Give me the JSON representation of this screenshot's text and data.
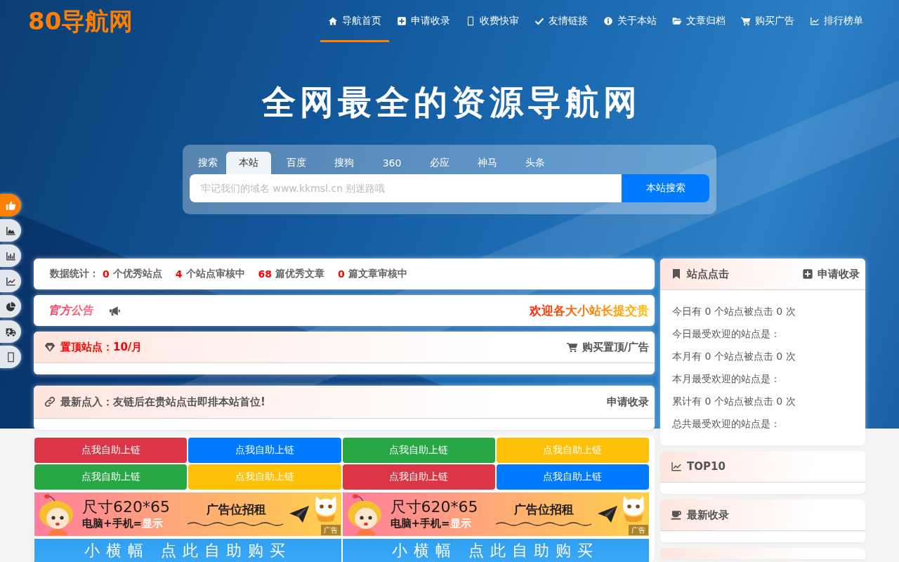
{
  "header": {
    "logo": "80导航网",
    "nav": [
      {
        "label": "导航首页",
        "selected": true
      },
      {
        "label": "申请收录",
        "selected": false
      },
      {
        "label": "收费快审",
        "selected": false
      },
      {
        "label": "友情链接",
        "selected": false
      },
      {
        "label": "关于本站",
        "selected": false
      },
      {
        "label": "文章归档",
        "selected": false
      },
      {
        "label": "购买广告",
        "selected": false
      },
      {
        "label": "排行榜单",
        "selected": false
      }
    ]
  },
  "hero": {
    "title": "全网最全的资源导航网"
  },
  "search": {
    "label": "搜索",
    "tabs": [
      {
        "label": "本站",
        "selected": true
      },
      {
        "label": "百度",
        "selected": false
      },
      {
        "label": "搜狗",
        "selected": false
      },
      {
        "label": "360",
        "selected": false
      },
      {
        "label": "必应",
        "selected": false
      },
      {
        "label": "神马",
        "selected": false
      },
      {
        "label": "头条",
        "selected": false
      }
    ],
    "placeholder": "牢记我们的域名 www.kkmsl.cn 别迷路哦",
    "button": "本站搜索"
  },
  "side_toolbar": [
    {
      "selected": true
    },
    {
      "selected": false
    },
    {
      "selected": false
    },
    {
      "selected": false
    },
    {
      "selected": false
    },
    {
      "selected": false
    },
    {
      "selected": false
    }
  ],
  "stats": {
    "label": "数据统计：",
    "items": [
      {
        "value": "0",
        "text": "个优秀站点"
      },
      {
        "value": "4",
        "text": "个站点审核中"
      },
      {
        "value": "68",
        "text": "篇优秀文章"
      },
      {
        "value": "0",
        "text": "篇文章审核中"
      }
    ]
  },
  "notice": {
    "title": "官方公告",
    "message": "欢迎各大小站长提交贵"
  },
  "pinned": {
    "title": "置顶站点：10/月",
    "action": "购买置顶/广告"
  },
  "latest": {
    "title": "最新点入：友链后在贵站点击即排本站首位!",
    "action": "申请收录"
  },
  "link_buttons": [
    {
      "label": "点我自助上链",
      "color": "#dc3545"
    },
    {
      "label": "点我自助上链",
      "color": "#007bff"
    },
    {
      "label": "点我自助上链",
      "color": "#28a745"
    },
    {
      "label": "点我自助上链",
      "color": "#ffc107"
    },
    {
      "label": "点我自助上链",
      "color": "#28a745"
    },
    {
      "label": "点我自助上链",
      "color": "#ffc107"
    },
    {
      "label": "点我自助上链",
      "color": "#dc3545"
    },
    {
      "label": "点我自助上链",
      "color": "#007bff"
    }
  ],
  "ad_banners": [
    {
      "size": "尺寸620*65",
      "devices": "电脑+手机=",
      "devices_highlight": "显示",
      "slogan": "广告位招租",
      "tag": "广告"
    },
    {
      "size": "尺寸620*65",
      "devices": "电脑+手机=",
      "devices_highlight": "显示",
      "slogan": "广告位招租",
      "tag": "广告"
    }
  ],
  "small_banners": [
    {
      "text": "小横幅 点此自助购买"
    },
    {
      "text": "小横幅 点此自助购买"
    }
  ],
  "click_stats": {
    "title": "站点点击",
    "action": "申请收录",
    "lines": [
      "今日有 0 个站点被点击 0 次",
      "今日最受欢迎的站点是：",
      "本月有 0 个站点被点击 0 次",
      "本月最受欢迎的站点是：",
      "累计有 0 个站点被点击 0 次",
      "总共最受欢迎的站点是："
    ]
  },
  "top10": {
    "title": "TOP10"
  },
  "recent": {
    "title": "最新收录"
  }
}
